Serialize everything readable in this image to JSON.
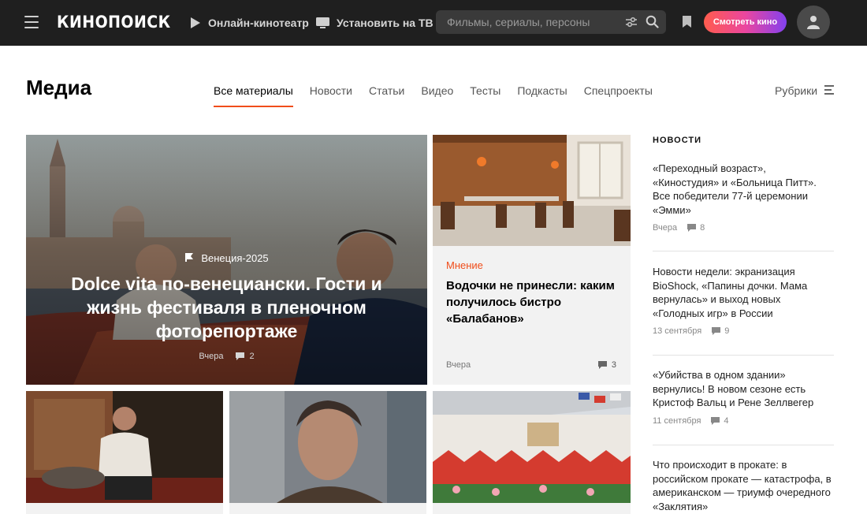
{
  "header": {
    "logo": "КИНОПОИСК",
    "online_cinema": "Онлайн-кинотеатр",
    "install_tv": "Установить на ТВ",
    "search_placeholder": "Фильмы, сериалы, персоны",
    "watch_button": "Смотреть кино",
    "accent_gradient": [
      "#ff5c4d",
      "#eb469f",
      "#8341ef"
    ]
  },
  "page": {
    "title": "Медиа",
    "tabs": [
      {
        "label": "Все материалы",
        "active": true
      },
      {
        "label": "Новости",
        "active": false
      },
      {
        "label": "Статьи",
        "active": false
      },
      {
        "label": "Видео",
        "active": false
      },
      {
        "label": "Тесты",
        "active": false
      },
      {
        "label": "Подкасты",
        "active": false
      },
      {
        "label": "Спецпроекты",
        "active": false
      }
    ],
    "rubrics": "Рубрики",
    "accent_color": "#f04d1a"
  },
  "hero": {
    "tag": "Венеция-2025",
    "title": "Dolce vita по-венециански. Гости и жизнь фестиваля в пленочном фоторепортаже",
    "date": "Вчера",
    "comments": "2"
  },
  "card": {
    "kicker": "Мнение",
    "title": "Водочки не принесли: каким получилось бистро «Балабанов»",
    "date": "Вчера",
    "comments": "3"
  },
  "news": {
    "heading": "НОВОСТИ",
    "items": [
      {
        "text": "«Переходный возраст», «Киностудия» и «Больница Питт». Все победители 77-й церемонии «Эмми»",
        "date": "Вчера",
        "comments": "8"
      },
      {
        "text": "Новости недели: экранизация BioShock, «Папины дочки. Мама вернулась» и выход новых «Голодных игр» в России",
        "date": "13 сентября",
        "comments": "9"
      },
      {
        "text": "«Убийства в одном здании» вернулись! В новом сезоне есть Кристоф Вальц и Рене Зеллвегер",
        "date": "11 сентября",
        "comments": "4"
      },
      {
        "text": "Что происходит в прокате: в российском прокате — катастрофа, в американском — триумф очередного «Заклятия»",
        "date": "",
        "comments": ""
      }
    ]
  }
}
